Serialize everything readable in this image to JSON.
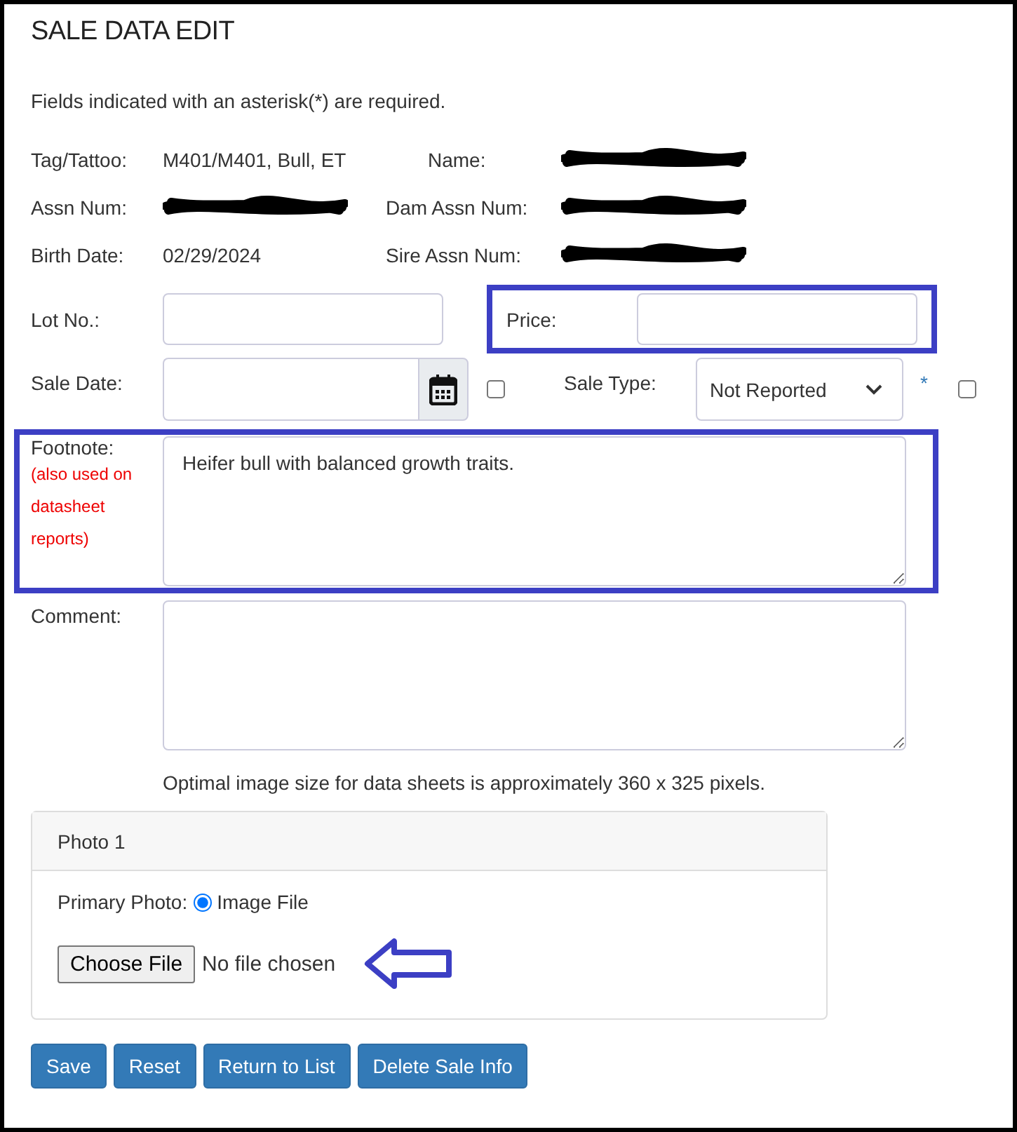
{
  "title": "SALE DATA EDIT",
  "required_note": "Fields indicated with an asterisk(*) are required.",
  "info_rows": [
    [
      {
        "label": "Tag/Tattoo:",
        "value": "M401/M401, Bull, ET"
      },
      {
        "label": "Name:",
        "redacted": true
      }
    ],
    [
      {
        "label": "Assn Num:",
        "redacted": true
      },
      {
        "label": "Dam Assn Num:",
        "redacted": true
      }
    ],
    [
      {
        "label": "Birth Date:",
        "value": "02/29/2024"
      },
      {
        "label": "Sire Assn Num:",
        "redacted": true
      }
    ]
  ],
  "lot": {
    "label": "Lot No.:"
  },
  "price": {
    "label": "Price:",
    "highlighted": true
  },
  "sale_date": {
    "label": "Sale Date:",
    "checked": false
  },
  "sale_type": {
    "label": "Sale Type:",
    "value": "Not Reported",
    "required_mark": "*",
    "checked": false
  },
  "footnote": {
    "label": "Footnote:",
    "note": "(also used on datasheet reports)",
    "value": "Heifer bull with balanced growth traits.",
    "highlighted": true
  },
  "comment": {
    "label": "Comment:"
  },
  "image_hint": "Optimal image size for data sheets is approximately 360 x 325 pixels.",
  "photo_card": {
    "title": "Photo 1",
    "primary_label": "Primary Photo:",
    "option": {
      "label": "Image File",
      "selected": true
    },
    "file_button": "Choose File",
    "file_status": "No file chosen"
  },
  "buttons": [
    "Save",
    "Reset",
    "Return to List",
    "Delete Sale Info"
  ]
}
